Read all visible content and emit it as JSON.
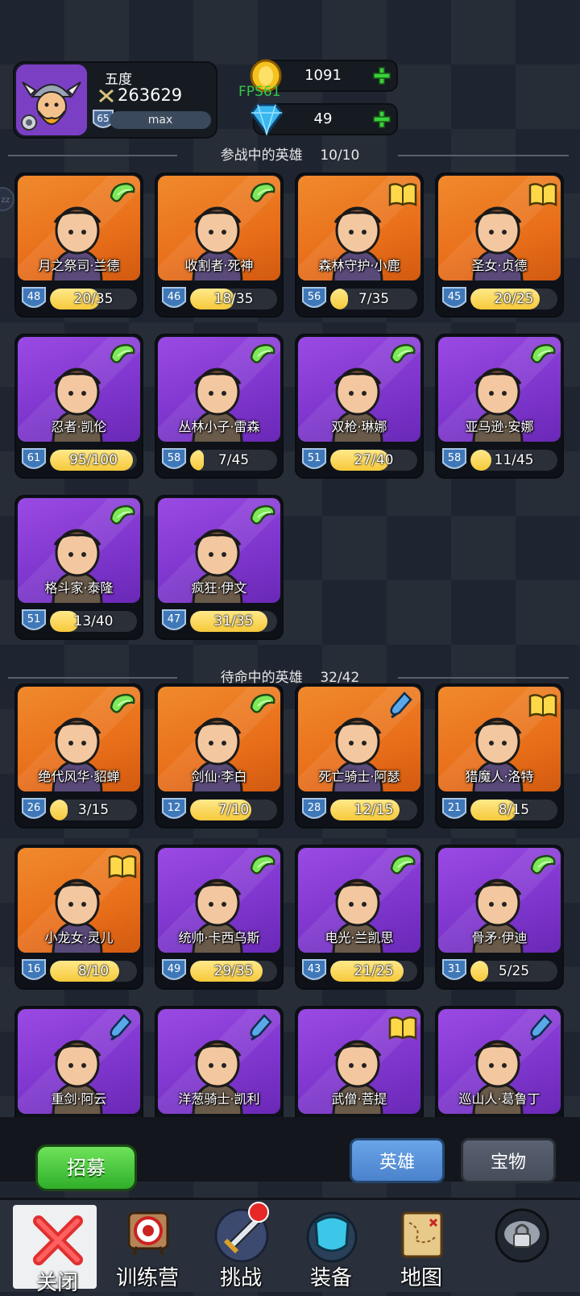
{
  "header": {
    "player_name": "五度",
    "power": "263629",
    "level": "65",
    "level_status": "max",
    "gold": "1091",
    "gems": "49",
    "fps": "FPS61"
  },
  "sections": {
    "active_title": "参战中的英雄",
    "active_count": "10/10",
    "standby_title": "待命中的英雄",
    "standby_count": "32/42"
  },
  "active_heroes": [
    {
      "name": "月之祭司·兰德",
      "level": "48",
      "progress": "20/35",
      "ratio": 0.57,
      "bg": "orange",
      "badge": "wing"
    },
    {
      "name": "收割者·死神",
      "level": "46",
      "progress": "18/35",
      "ratio": 0.51,
      "bg": "orange",
      "badge": "wing"
    },
    {
      "name": "森林守护·小鹿",
      "level": "56",
      "progress": "7/35",
      "ratio": 0.2,
      "bg": "orange",
      "badge": "book"
    },
    {
      "name": "圣女·贞德",
      "level": "45",
      "progress": "20/25",
      "ratio": 0.8,
      "bg": "orange",
      "badge": "book"
    },
    {
      "name": "忍者·凯伦",
      "level": "61",
      "progress": "95/100",
      "ratio": 0.95,
      "bg": "purple",
      "badge": "wing"
    },
    {
      "name": "丛林小子·雷森",
      "level": "58",
      "progress": "7/45",
      "ratio": 0.16,
      "bg": "purple",
      "badge": "wing"
    },
    {
      "name": "双枪·琳娜",
      "level": "51",
      "progress": "27/40",
      "ratio": 0.68,
      "bg": "purple",
      "badge": "wing"
    },
    {
      "name": "亚马逊·安娜",
      "level": "58",
      "progress": "11/45",
      "ratio": 0.24,
      "bg": "purple",
      "badge": "wing"
    },
    {
      "name": "格斗家·泰隆",
      "level": "51",
      "progress": "13/40",
      "ratio": 0.33,
      "bg": "purple",
      "badge": "wing"
    },
    {
      "name": "疯狂·伊文",
      "level": "47",
      "progress": "31/35",
      "ratio": 0.89,
      "bg": "purple",
      "badge": "wing"
    }
  ],
  "standby_heroes": [
    {
      "name": "绝代风华·貂蝉",
      "level": "26",
      "progress": "3/15",
      "ratio": 0.2,
      "bg": "orange",
      "badge": "wing"
    },
    {
      "name": "剑仙·李白",
      "level": "12",
      "progress": "7/10",
      "ratio": 0.7,
      "bg": "orange",
      "badge": "wing"
    },
    {
      "name": "死亡骑士·阿瑟",
      "level": "28",
      "progress": "12/15",
      "ratio": 0.8,
      "bg": "orange",
      "badge": "potion"
    },
    {
      "name": "猎魔人·洛特",
      "level": "21",
      "progress": "8/15",
      "ratio": 0.53,
      "bg": "orange",
      "badge": "book"
    },
    {
      "name": "小龙女·灵儿",
      "level": "16",
      "progress": "8/10",
      "ratio": 0.8,
      "bg": "orange",
      "badge": "book"
    },
    {
      "name": "统帅·卡西乌斯",
      "level": "49",
      "progress": "29/35",
      "ratio": 0.83,
      "bg": "purple",
      "badge": "wing"
    },
    {
      "name": "电光·兰凯思",
      "level": "43",
      "progress": "21/25",
      "ratio": 0.84,
      "bg": "purple",
      "badge": "wing"
    },
    {
      "name": "骨矛·伊迪",
      "level": "31",
      "progress": "5/25",
      "ratio": 0.2,
      "bg": "purple",
      "badge": "wing"
    },
    {
      "name": "重剑·阿云",
      "level": "",
      "progress": "",
      "ratio": 0,
      "bg": "purple",
      "badge": "potion"
    },
    {
      "name": "洋葱骑士·凯利",
      "level": "",
      "progress": "",
      "ratio": 0,
      "bg": "purple",
      "badge": "potion"
    },
    {
      "name": "武僧·菩提",
      "level": "",
      "progress": "",
      "ratio": 0,
      "bg": "purple",
      "badge": "book"
    },
    {
      "name": "巡山人·葛鲁丁",
      "level": "",
      "progress": "",
      "ratio": 0,
      "bg": "purple",
      "badge": "potion"
    }
  ],
  "bottom": {
    "recruit_label": "招募",
    "tab_heroes": "英雄",
    "tab_treasure": "宝物"
  },
  "nav": [
    {
      "label": "关闭",
      "icon": "close-icon"
    },
    {
      "label": "训练营",
      "icon": "target-icon"
    },
    {
      "label": "挑战",
      "icon": "sword-icon"
    },
    {
      "label": "装备",
      "icon": "equipment-icon"
    },
    {
      "label": "地图",
      "icon": "map-icon"
    },
    {
      "label": "",
      "icon": "locked-icon"
    }
  ]
}
